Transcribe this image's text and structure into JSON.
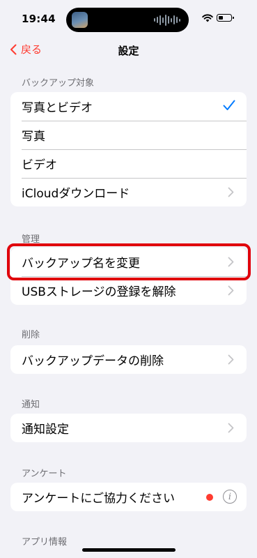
{
  "status_bar": {
    "time": "19:44"
  },
  "nav": {
    "back_label": "戻る",
    "title": "設定"
  },
  "sections": {
    "backup_target": {
      "header": "バックアップ対象",
      "items": [
        "写真とビデオ",
        "写真",
        "ビデオ",
        "iCloudダウンロード"
      ],
      "selected": "写真とビデオ"
    },
    "management": {
      "header": "管理",
      "items": [
        "バックアップ名を変更",
        "USBストレージの登録を解除"
      ],
      "highlighted": "バックアップ名を変更"
    },
    "delete": {
      "header": "削除",
      "items": [
        "バックアップデータの削除"
      ]
    },
    "notification": {
      "header": "通知",
      "items": [
        "通知設定"
      ]
    },
    "survey": {
      "header": "アンケート",
      "items": [
        "アンケートにご協力ください"
      ]
    },
    "app_info": {
      "header": "アプリ情報"
    }
  },
  "colors": {
    "accent_red": "#ff3b30",
    "check_blue": "#007aff",
    "highlight_red": "#e0000b",
    "background": "#f2f2f7"
  },
  "icons": [
    "wifi-icon",
    "battery-icon",
    "chevron-left-icon",
    "checkmark-icon",
    "chevron-right-icon",
    "info-icon",
    "notification-dot"
  ]
}
